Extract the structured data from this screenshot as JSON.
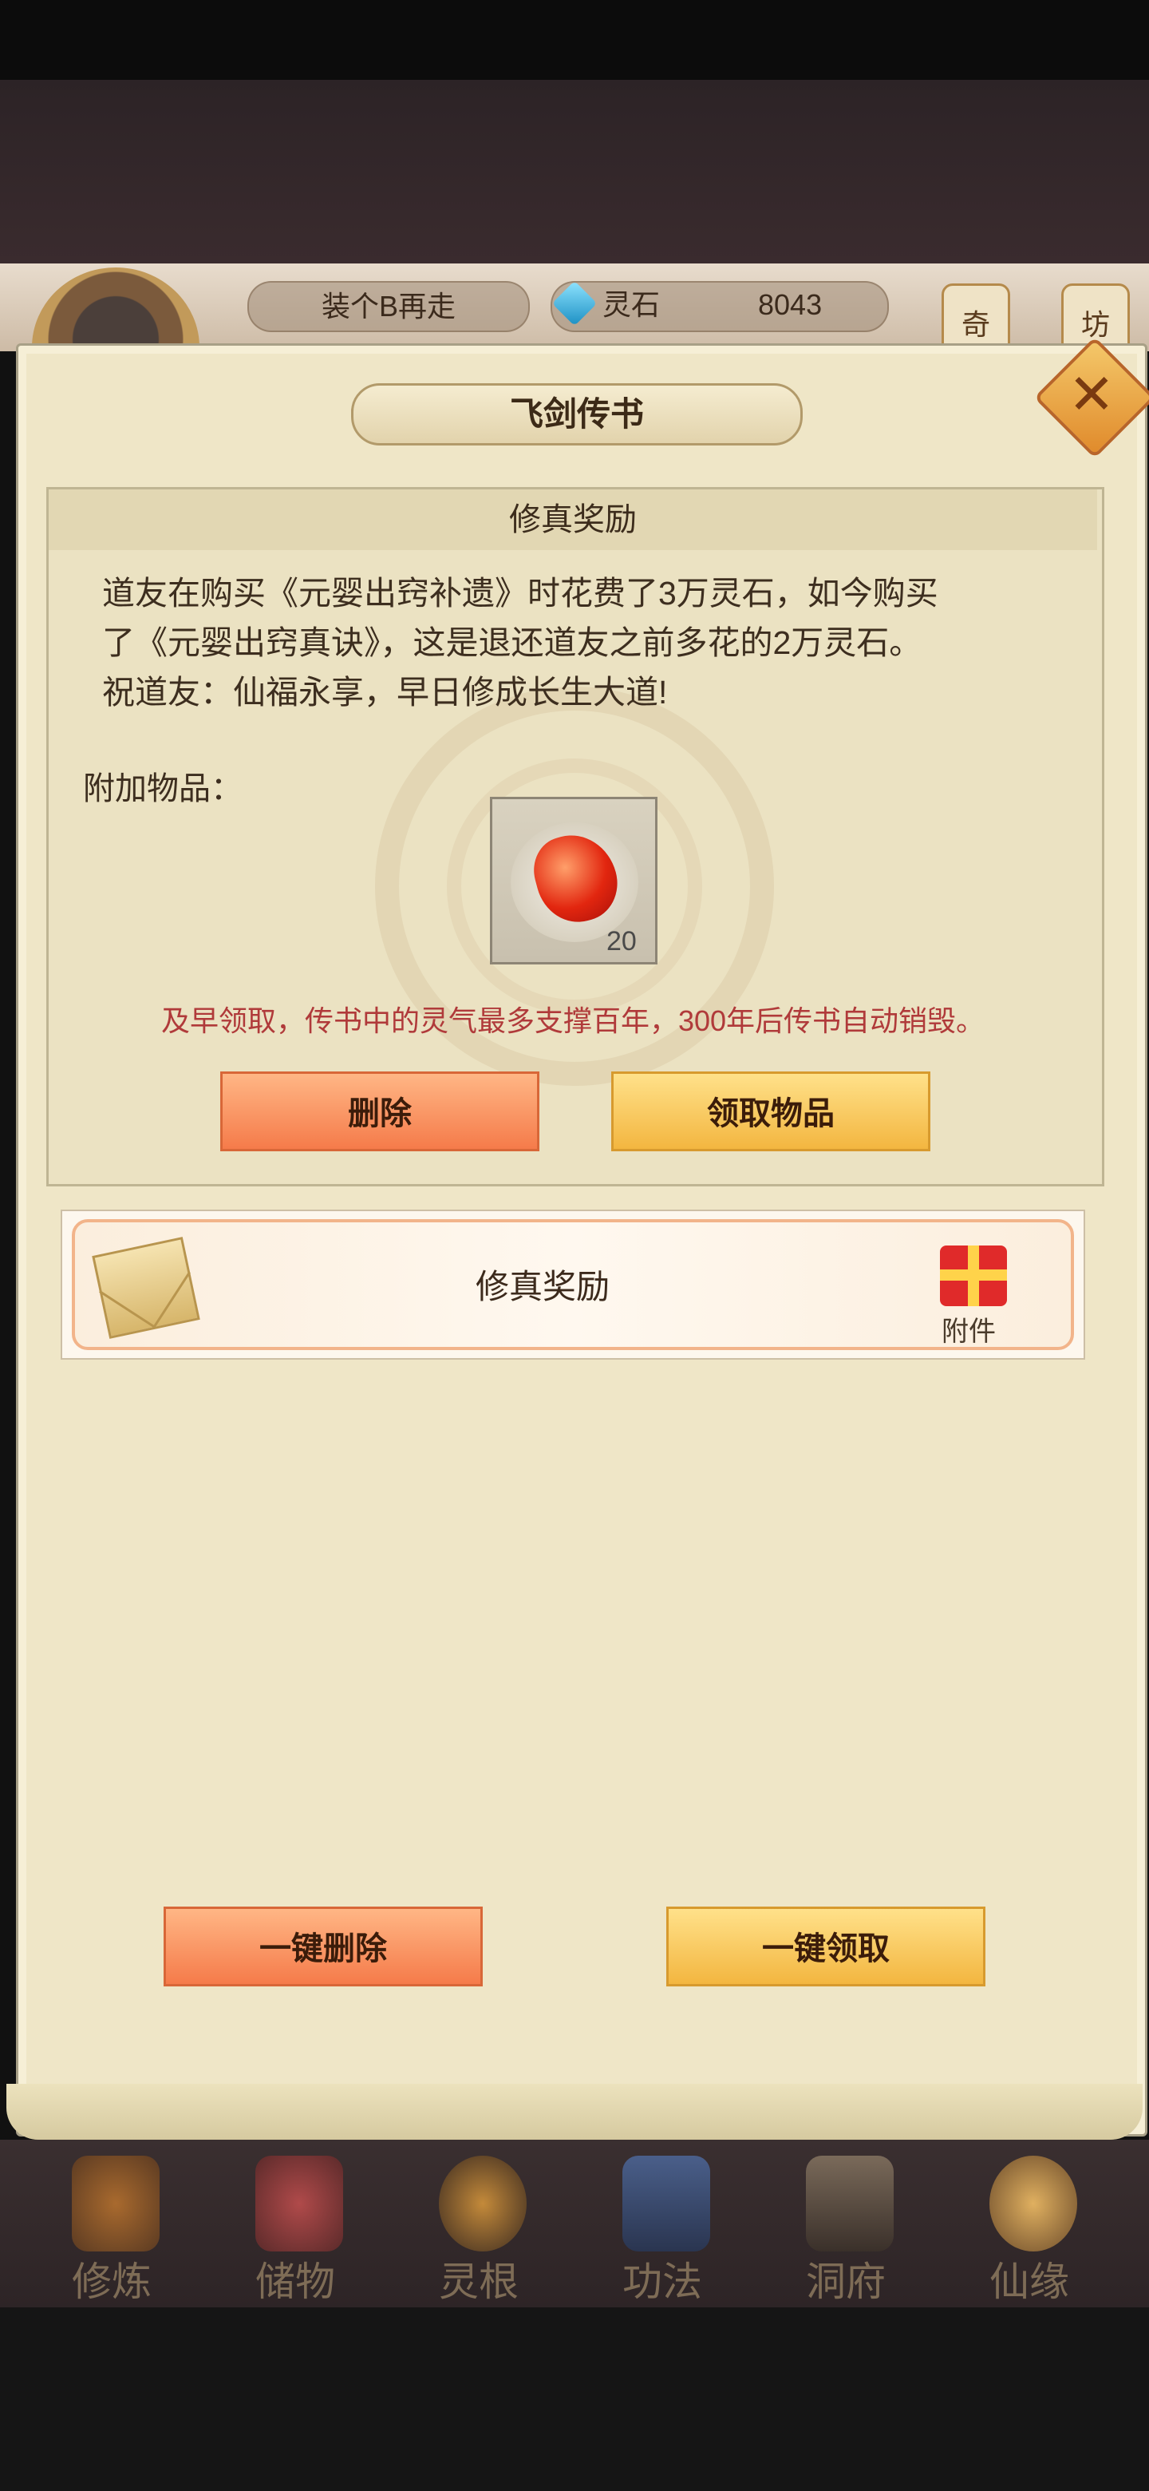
{
  "topbar": {
    "player_name": "装个B再走",
    "currency_label": "灵石",
    "currency_value": "8043",
    "side_tab_1": "奇",
    "side_tab_2": "坊"
  },
  "dialog": {
    "title": "飞剑传书",
    "close_icon": "close-icon"
  },
  "mail": {
    "header": "修真奖励",
    "body_line1": "道友在购买《元婴出窍补遗》时花费了3万灵石，如今购买",
    "body_line2": "了《元婴出窍真诀》，这是退还道友之前多花的2万灵石。",
    "body_line3": "祝道友：仙福永享，早日修成长生大道!",
    "attachment_label": "附加物品：",
    "item": {
      "icon": "ruby-stone-icon",
      "count": "20"
    },
    "warning": "及早领取，传书中的灵气最多支撑百年，300年后传书自动销毁。",
    "delete_label": "删除",
    "claim_label": "领取物品"
  },
  "list": [
    {
      "title": "修真奖励",
      "icon": "envelope-icon",
      "badge_icon": "gift-icon",
      "badge_label": "附件"
    }
  ],
  "actions": {
    "delete_all_label": "一键删除",
    "claim_all_label": "一键领取"
  },
  "nav": [
    {
      "label": "修炼",
      "icon": "cultivation-icon"
    },
    {
      "label": "储物",
      "icon": "storage-icon"
    },
    {
      "label": "灵根",
      "icon": "spirit-root-icon"
    },
    {
      "label": "功法",
      "icon": "skills-icon"
    },
    {
      "label": "洞府",
      "icon": "cave-icon"
    },
    {
      "label": "仙缘",
      "icon": "fate-icon"
    }
  ]
}
